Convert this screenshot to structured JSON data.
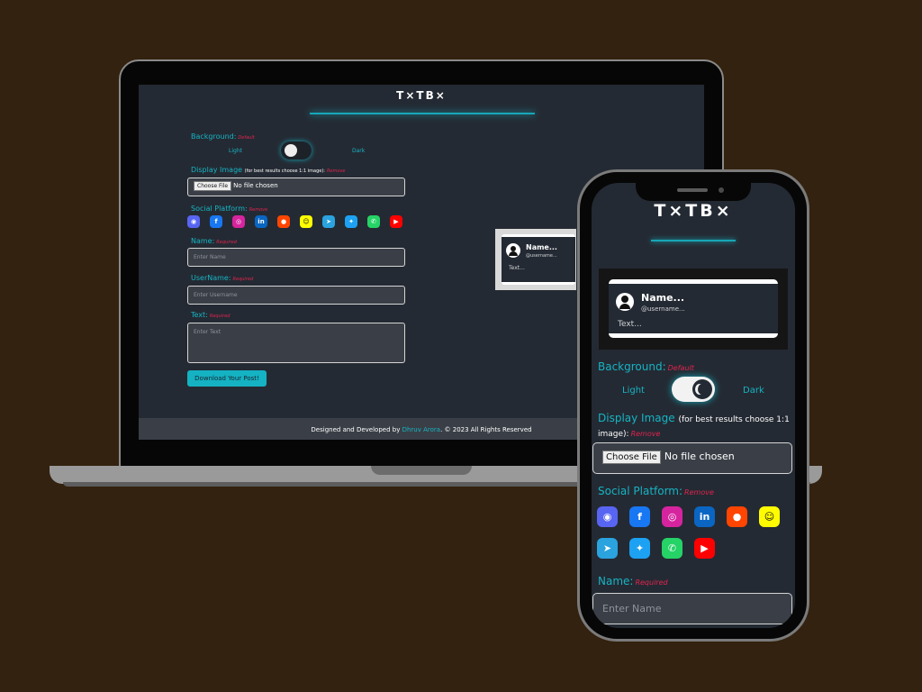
{
  "app": {
    "logo": "T×TB×"
  },
  "preview": {
    "name": "Name...",
    "username": "@username...",
    "text": "Text..."
  },
  "form": {
    "background_label": "Background:",
    "background_note": "Default",
    "light_label": "Light",
    "dark_label": "Dark",
    "display_image_label": "Display Image",
    "display_image_sub": "(for best results choose 1:1 image):",
    "display_image_note": "Remove",
    "choose_file": "Choose File",
    "no_file": "No file chosen",
    "social_label": "Social Platform:",
    "social_note": "Remove",
    "name_label": "Name:",
    "name_note": "Required",
    "name_placeholder": "Enter Name",
    "username_label": "UserName:",
    "username_note": "Required",
    "username_placeholder": "Enter Username",
    "text_label": "Text:",
    "text_note": "Required",
    "text_placeholder": "Enter Text",
    "download_button": "Download Your Post!"
  },
  "footer": {
    "prefix": "Designed and Developed by",
    "author": "Dhruv Arora",
    "suffix": ". © 2023 All Rights Reserved"
  },
  "social_icons": [
    {
      "name": "discord-icon",
      "glyph": "◉",
      "color": "#5865f2"
    },
    {
      "name": "facebook-icon",
      "glyph": "f",
      "color": "#1877f2"
    },
    {
      "name": "instagram-icon",
      "glyph": "◎",
      "color": "#d6249f"
    },
    {
      "name": "linkedin-icon",
      "glyph": "in",
      "color": "#0a66c2"
    },
    {
      "name": "reddit-icon",
      "glyph": "●",
      "color": "#ff4500"
    },
    {
      "name": "snapchat-icon",
      "glyph": "☺",
      "color": "#fffc00"
    },
    {
      "name": "telegram-icon",
      "glyph": "➤",
      "color": "#2aa3df"
    },
    {
      "name": "twitter-icon",
      "glyph": "✦",
      "color": "#1da1f2"
    },
    {
      "name": "whatsapp-icon",
      "glyph": "✆",
      "color": "#25d366"
    },
    {
      "name": "youtube-icon",
      "glyph": "▶",
      "color": "#ff0000"
    }
  ],
  "colors": {
    "accent": "#16b4c4",
    "required": "#e0244f",
    "surface": "#242a33",
    "backdrop": "#33220f"
  }
}
